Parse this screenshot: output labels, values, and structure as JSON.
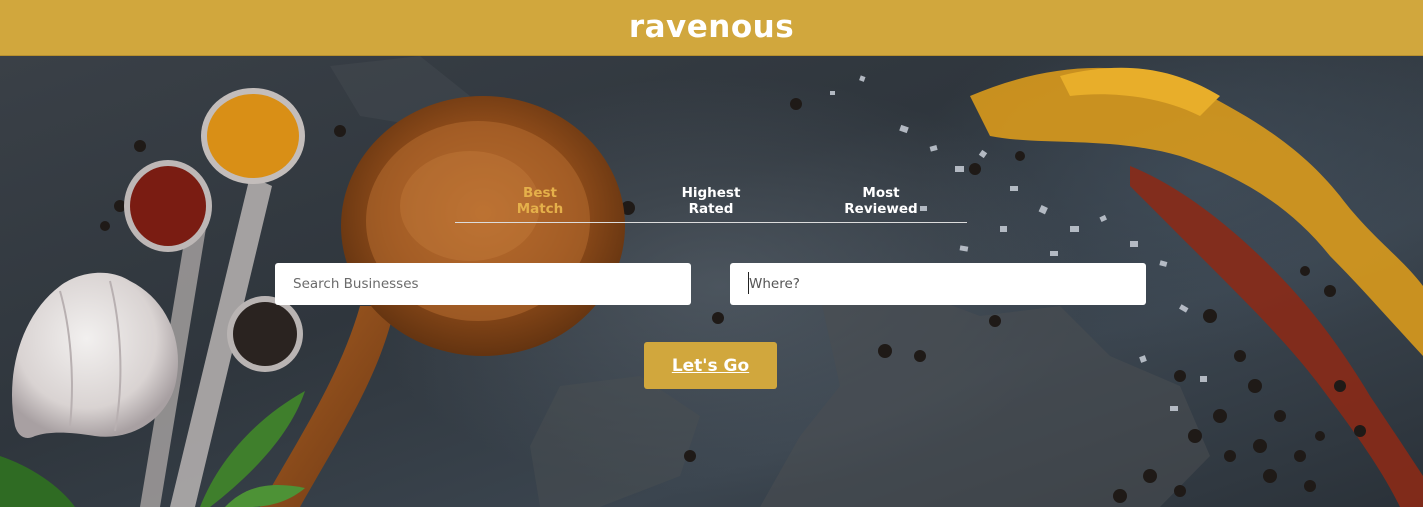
{
  "header": {
    "logo_text": "ravenous"
  },
  "sort_options": [
    {
      "line1": "Best",
      "line2": "Match",
      "active": true
    },
    {
      "line1": "Highest",
      "line2": "Rated",
      "active": false
    },
    {
      "line1": "Most",
      "line2": "Reviewed",
      "active": false
    }
  ],
  "search": {
    "business_placeholder": "Search Businesses",
    "location_placeholder": "Where?",
    "submit_label": "Let's Go"
  },
  "colors": {
    "brand": "#d1a73d",
    "active_sort": "#e5b04a",
    "text_on_dark": "#ffffff"
  }
}
